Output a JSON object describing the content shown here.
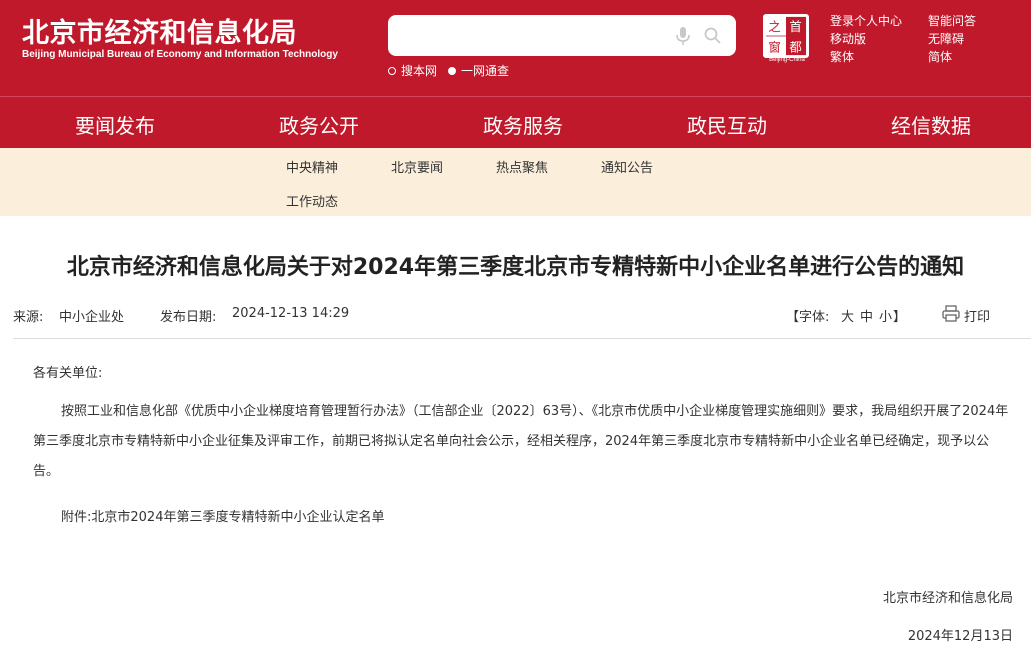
{
  "header": {
    "logo_cn": "北京市经济和信息化局",
    "logo_en": "Beijing Municipal Bureau of Economy and Information Technology",
    "search": {
      "value": "",
      "placeholder": ""
    },
    "scope_options": [
      "搜本网",
      "一网通查"
    ],
    "seal_chars": [
      "之",
      "首",
      "窗",
      "都"
    ],
    "seal_caption": "Beijing-China",
    "links": {
      "login": "登录个人中心",
      "qa": "智能问答",
      "mobile": "移动版",
      "accessible": "无障碍",
      "traditional": "繁体",
      "simplified": "简体"
    }
  },
  "main_nav": [
    "要闻发布",
    "政务公开",
    "政务服务",
    "政民互动",
    "经信数据"
  ],
  "sub_nav": [
    "中央精神",
    "北京要闻",
    "热点聚焦",
    "通知公告",
    "工作动态"
  ],
  "article": {
    "title": "北京市经济和信息化局关于对2024年第三季度北京市专精特新中小企业名单进行公告的通知",
    "source_label": "来源:",
    "source": "中小企业处",
    "date_label": "发布日期:",
    "date": "2024-12-13 14:29",
    "font_open": "【字体:",
    "font_sizes": [
      "大",
      "中",
      "小"
    ],
    "font_close": "】",
    "print": "打印",
    "salutation": "各有关单位:",
    "body": "按照工业和信息化部《优质中小企业梯度培育管理暂行办法》（工信部企业〔2022〕63号）、《北京市优质中小企业梯度管理实施细则》要求，我局组织开展了2024年第三季度北京市专精特新中小企业征集及评审工作，前期已将拟认定名单向社会公示，经相关程序，2024年第三季度北京市专精特新中小企业名单已经确定，现予以公告。",
    "attachment_label": "附件:",
    "attachment": "北京市2024年第三季度专精特新中小企业认定名单",
    "signature": "北京市经济和信息化局",
    "sign_date": "2024年12月13日"
  }
}
